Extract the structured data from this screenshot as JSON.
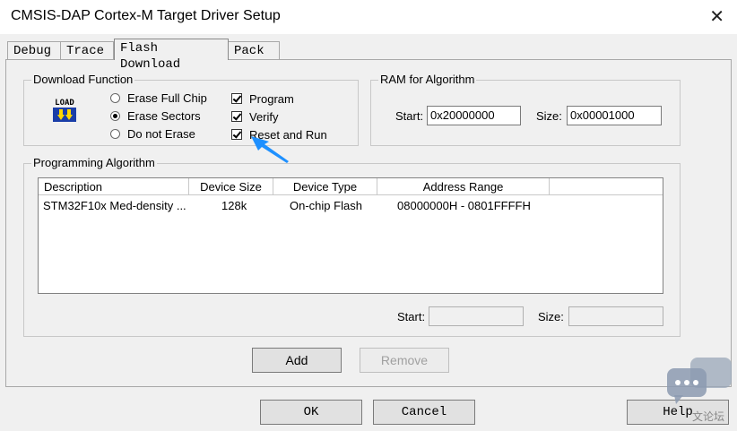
{
  "window": {
    "title": "CMSIS-DAP Cortex-M Target Driver Setup"
  },
  "tabs": [
    {
      "label": "Debug"
    },
    {
      "label": "Trace"
    },
    {
      "label": "Flash Download"
    },
    {
      "label": "Pack"
    }
  ],
  "download_function": {
    "legend": "Download Function",
    "icon_text": "LOAD",
    "erase_options": [
      {
        "label": "Erase Full Chip",
        "selected": false
      },
      {
        "label": "Erase Sectors",
        "selected": true
      },
      {
        "label": "Do not Erase",
        "selected": false
      }
    ],
    "checks": [
      {
        "label": "Program",
        "checked": true
      },
      {
        "label": "Verify",
        "checked": true
      },
      {
        "label": "Reset and Run",
        "checked": true
      }
    ]
  },
  "ram": {
    "legend": "RAM for Algorithm",
    "start_label": "Start:",
    "start_value": "0x20000000",
    "size_label": "Size:",
    "size_value": "0x00001000"
  },
  "programming_algorithm": {
    "legend": "Programming Algorithm",
    "columns": [
      "Description",
      "Device Size",
      "Device Type",
      "Address Range"
    ],
    "rows": [
      [
        "STM32F10x Med-density ...",
        "128k",
        "On-chip Flash",
        "08000000H - 0801FFFFH"
      ]
    ],
    "start_label": "Start:",
    "start_value": "",
    "size_label": "Size:",
    "size_value": ""
  },
  "buttons": {
    "add": "Add",
    "remove": "Remove",
    "ok": "OK",
    "cancel": "Cancel",
    "help": "Help"
  },
  "watermark": {
    "text": "文论坛"
  },
  "colors": {
    "arrow": "#1e90ff"
  }
}
